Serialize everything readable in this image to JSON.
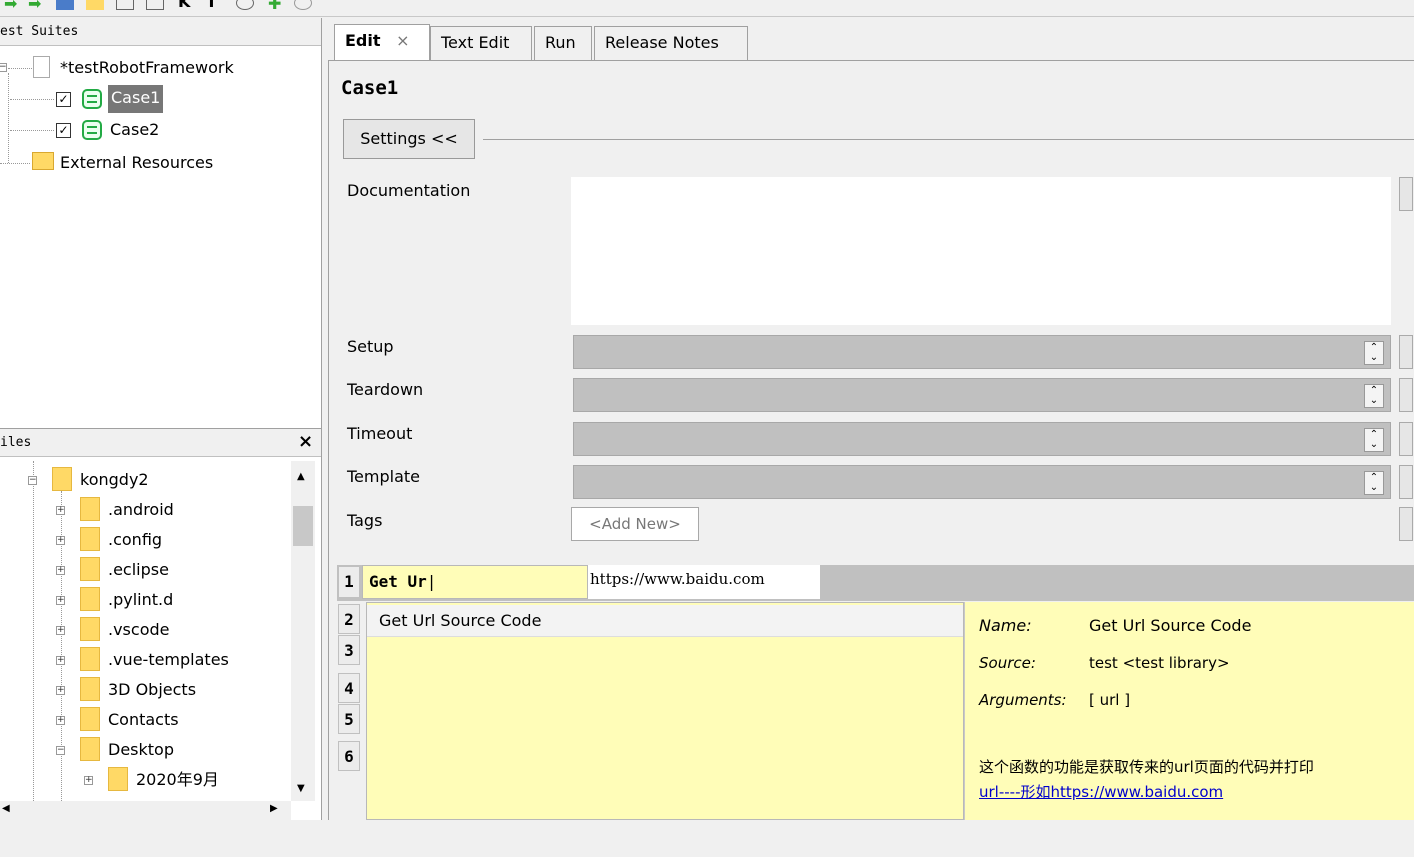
{
  "left": {
    "suites_header": "est Suites",
    "suite_name": "*testRobotFramework",
    "cases": [
      "Case1",
      "Case2"
    ],
    "external": "External Resources",
    "files_header": "iles",
    "files_close": "×",
    "folders": [
      "kongdy2",
      ".android",
      ".config",
      ".eclipse",
      ".pylint.d",
      ".vscode",
      ".vue-templates",
      "3D Objects",
      "Contacts",
      "Desktop",
      "2020年9月"
    ]
  },
  "tabs": [
    {
      "label": "Edit",
      "close": "×",
      "active": true
    },
    {
      "label": "Text Edit"
    },
    {
      "label": "Run"
    },
    {
      "label": "Release Notes"
    }
  ],
  "editor": {
    "title": "Case1",
    "settings_button": "Settings <<",
    "labels": {
      "documentation": "Documentation",
      "setup": "Setup",
      "teardown": "Teardown",
      "timeout": "Timeout",
      "template": "Template",
      "tags": "Tags"
    },
    "tags_placeholder": "<Add New>"
  },
  "grid": {
    "row_numbers": [
      "1",
      "2",
      "3",
      "4",
      "5",
      "6"
    ],
    "cell1": "Get Ur",
    "cell2": "https://www.baidu.com"
  },
  "autocomplete": {
    "items": [
      "Get Url Source Code"
    ]
  },
  "keyword_info": {
    "name_label": "Name:",
    "name_value": "Get Url Source Code",
    "source_label": "Source:",
    "source_value": "test <test library>",
    "args_label": "Arguments:",
    "args_value": "[ url ]",
    "doc_line1": "这个函数的功能是获取传来的url页面的代码并打印",
    "doc_line2": "url----形如https://www.baidu.com"
  },
  "colors": {
    "accent_green": "#22aa44",
    "tooltip_yellow": "#fffdb8",
    "link_blue": "#0000cc"
  }
}
